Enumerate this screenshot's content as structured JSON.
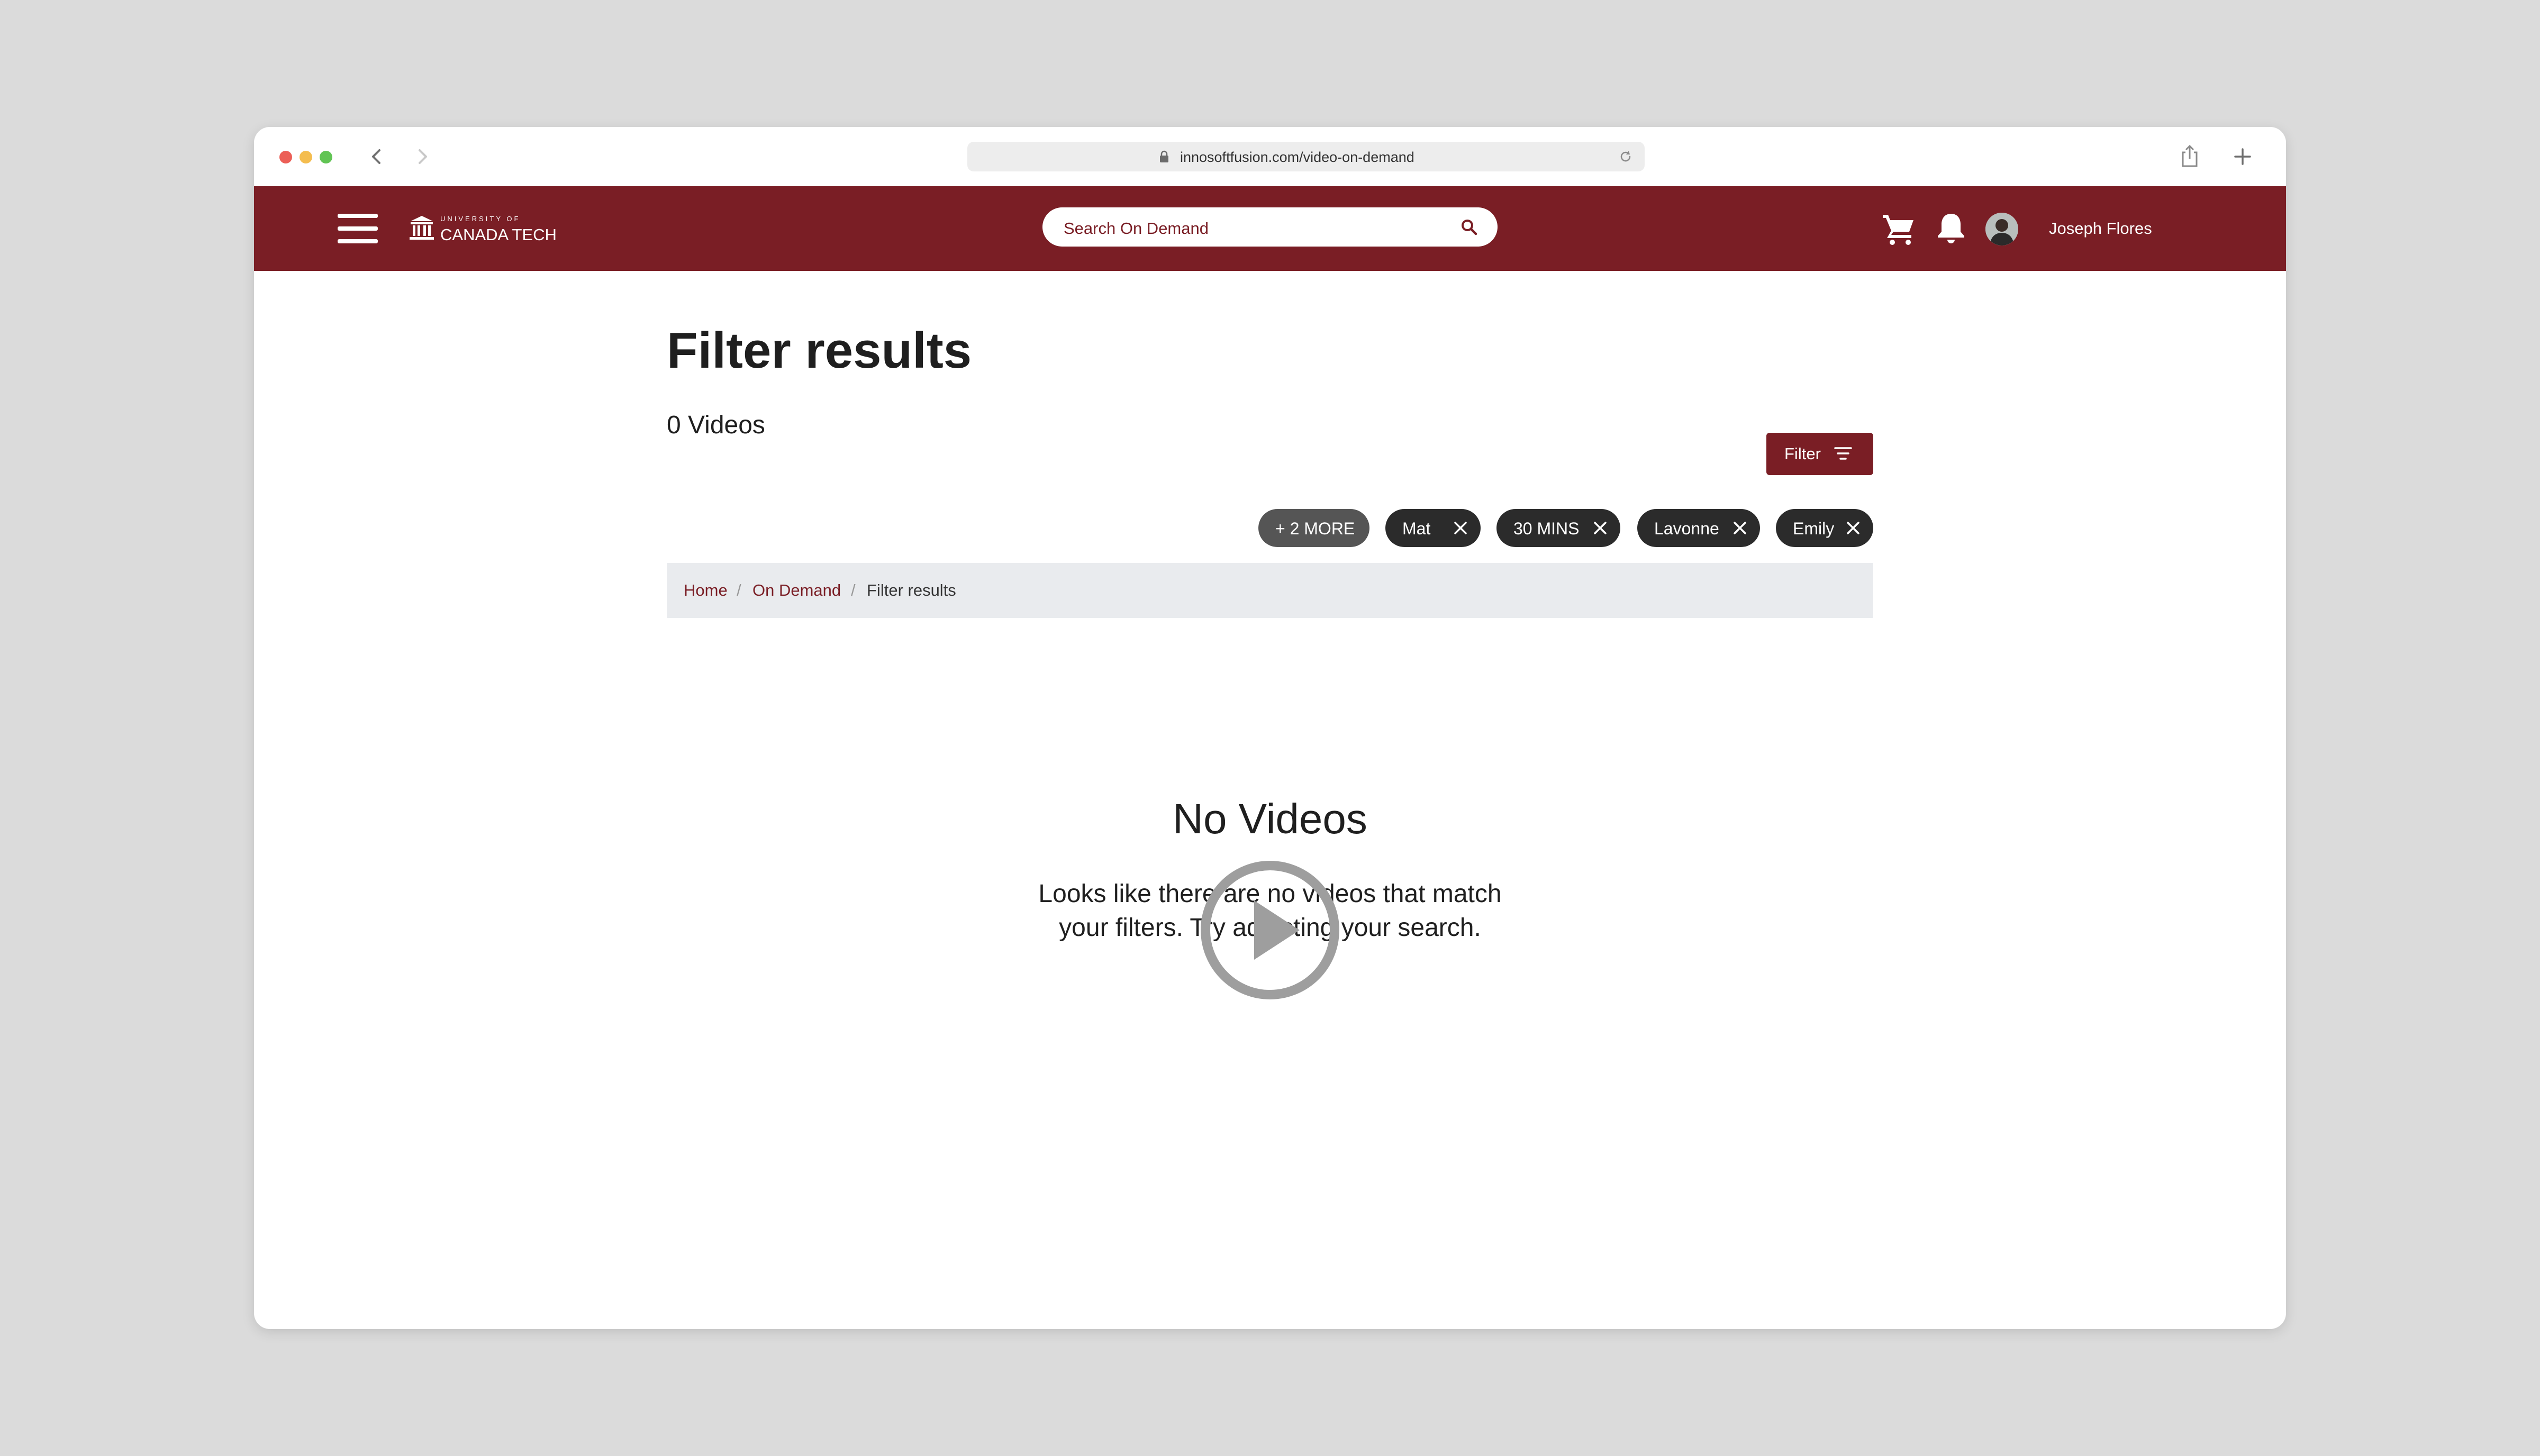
{
  "browser": {
    "url": "innosoftfusion.com/video-on-demand"
  },
  "header": {
    "logo_small": "UNIVERSITY OF",
    "logo_big": "CANADA TECH",
    "search_placeholder": "Search On Demand",
    "user_name": "Joseph Flores"
  },
  "main": {
    "title": "Filter results",
    "count": "0 Videos",
    "filter_label": "Filter",
    "chips": [
      {
        "label": "+ 2 MORE"
      },
      {
        "label": "Mat"
      },
      {
        "label": "30 MINS"
      },
      {
        "label": "Lavonne"
      },
      {
        "label": "Emily"
      }
    ],
    "breadcrumb": {
      "items": [
        "Home",
        "On Demand",
        "Filter results"
      ],
      "separator": "/"
    },
    "empty": {
      "title": "No Videos",
      "line1": "Looks like there are no videos that match",
      "line2": "your filters. Try adjusting your search."
    }
  },
  "colors": {
    "brand": "#7a1e25",
    "chip": "#2b2b2b",
    "chip_more": "#555555",
    "breadcrumb_bg": "#e9ebee",
    "play_icon": "#9e9e9e"
  },
  "icons": [
    "back-arrow-icon",
    "forward-arrow-icon",
    "lock-icon",
    "reload-icon",
    "share-icon",
    "new-tab-icon",
    "hamburger-menu-icon",
    "university-logo-icon",
    "search-icon",
    "cart-icon",
    "bell-icon",
    "filter-icon",
    "close-icon",
    "play-circle-icon"
  ]
}
